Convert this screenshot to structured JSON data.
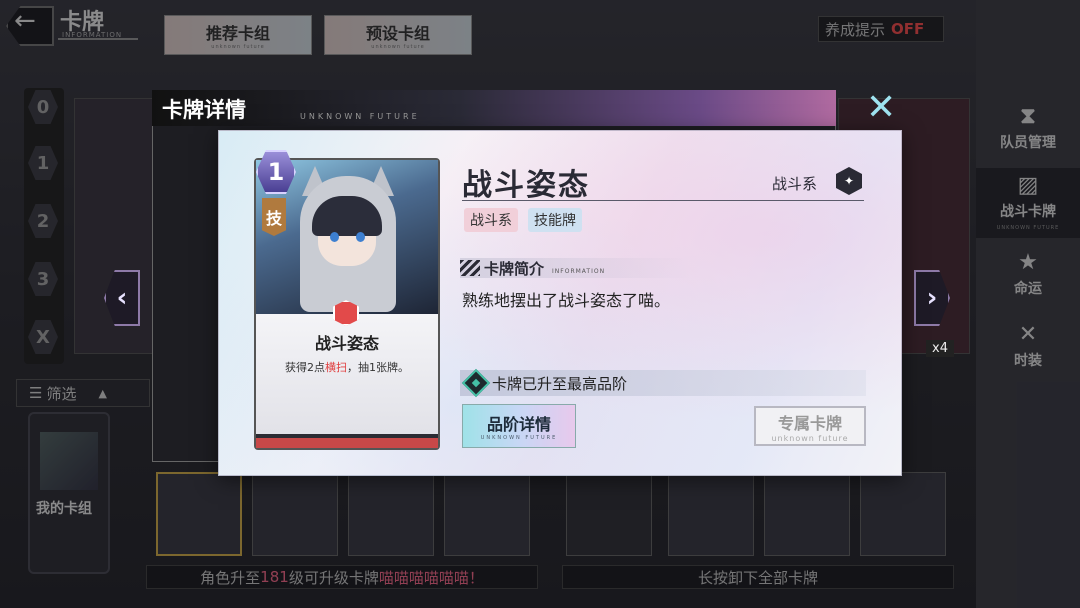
{
  "topbar": {
    "title": "卡牌",
    "title_sub": "INFORMATION",
    "tabs": [
      {
        "label": "推荐卡组",
        "sub": "unknown future"
      },
      {
        "label": "预设卡组",
        "sub": "unknown future"
      }
    ],
    "hint_label": "养成提示",
    "hint_state": "OFF"
  },
  "cost_filter": [
    "0",
    "1",
    "2",
    "3",
    "X"
  ],
  "filter_label": "筛选",
  "my_deck_label": "我的卡组",
  "bottom_strip_left": {
    "pre": "角色升至",
    "level": "181",
    "post": "级可升级卡牌",
    "tail": "喵喵喵喵喵喵！"
  },
  "bottom_strip_right": "长按卸下全部卡牌",
  "background_card_count": "x4",
  "sidebar": [
    {
      "icon": "hourglass-icon",
      "glyph": "⧗",
      "label": "队员管理",
      "sub": ""
    },
    {
      "icon": "cards-icon",
      "glyph": "▨",
      "label": "战斗卡牌",
      "sub": "UNKNOWN FUTURE"
    },
    {
      "icon": "star-icon",
      "glyph": "★",
      "label": "命运",
      "sub": ""
    },
    {
      "icon": "crossed-swords-icon",
      "glyph": "✕",
      "label": "时装",
      "sub": ""
    }
  ],
  "dialog": {
    "header_title": "卡牌详情",
    "header_sub": "UNKNOWN FUTURE",
    "close_glyph": "✕",
    "card": {
      "cost": "1",
      "type_glyph": "技",
      "name": "战斗姿态",
      "desc_pre": "获得2点",
      "desc_keyword": "横扫",
      "desc_post": "，抽1张牌。"
    },
    "title": "战斗姿态",
    "faction": "战斗系",
    "tags": [
      "战斗系",
      "技能牌"
    ],
    "section_title": "卡牌简介",
    "section_sub": "INFORMATION",
    "intro": "熟练地摆出了战斗姿态了喵。",
    "max_grade_text": "卡牌已升至最高品阶",
    "grade_button": {
      "label": "品阶详情",
      "sub": "UNKNOWN FUTURE"
    },
    "exclusive_button": {
      "label": "专属卡牌",
      "sub": "unknown future"
    }
  },
  "colors": {
    "accent_red": "#e03d3d",
    "off_red": "#ff4e4e",
    "teal": "#45c0a6",
    "close_blue": "#9fe3f0"
  }
}
